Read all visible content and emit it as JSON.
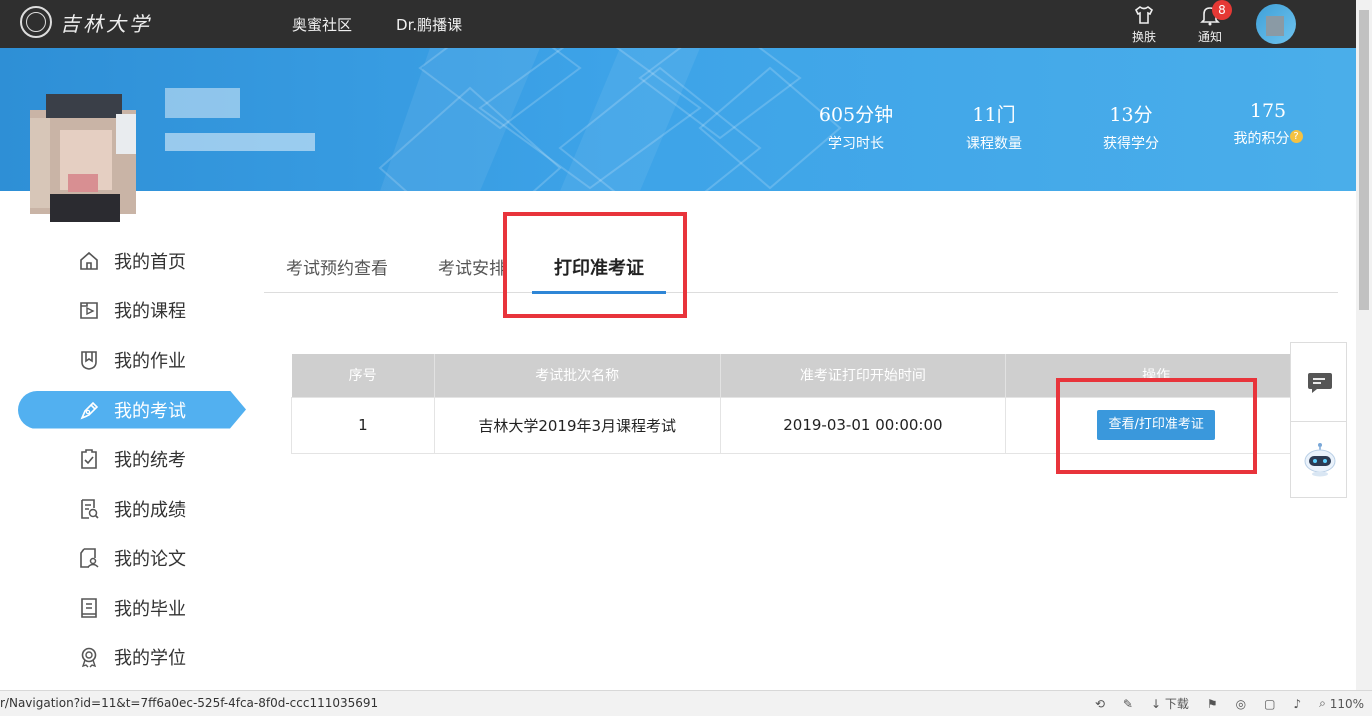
{
  "topbar": {
    "logo_text": "吉林大学",
    "nav": [
      "奥蜜社区",
      "Dr.鹏播课"
    ],
    "skin_label": "换肤",
    "notify_label": "通知",
    "notify_count": "8"
  },
  "stats": [
    {
      "value": "605分钟",
      "label": "学习时长"
    },
    {
      "value": "11门",
      "label": "课程数量"
    },
    {
      "value": "13分",
      "label": "获得学分"
    },
    {
      "value": "175",
      "label": "我的积分"
    }
  ],
  "sidebar": {
    "items": [
      {
        "label": "我的首页",
        "icon": "home-icon"
      },
      {
        "label": "我的课程",
        "icon": "course-icon"
      },
      {
        "label": "我的作业",
        "icon": "homework-icon"
      },
      {
        "label": "我的考试",
        "icon": "exam-icon"
      },
      {
        "label": "我的统考",
        "icon": "unified-exam-icon"
      },
      {
        "label": "我的成绩",
        "icon": "grades-icon"
      },
      {
        "label": "我的论文",
        "icon": "thesis-icon"
      },
      {
        "label": "我的毕业",
        "icon": "graduation-icon"
      },
      {
        "label": "我的学位",
        "icon": "degree-icon"
      }
    ],
    "active_index": 3
  },
  "tabs": [
    {
      "label": "考试预约查看"
    },
    {
      "label": "考试安排"
    },
    {
      "label": "打印准考证"
    }
  ],
  "table": {
    "headers": [
      "序号",
      "考试批次名称",
      "准考证打印开始时间",
      "操作"
    ],
    "rows": [
      {
        "index": "1",
        "batch": "吉林大学2019年3月课程考试",
        "start_time": "2019-03-01 00:00:00",
        "action": "查看/打印准考证"
      }
    ]
  },
  "statusbar": {
    "url": "r/Navigation?id=11&t=7ff6a0ec-525f-4fca-8f0d-ccc111035691",
    "download_label": "下载",
    "zoom": "110%"
  },
  "colors": {
    "topbar": "#2f2f2f",
    "banner": "#3da3e8",
    "accent": "#52b0f0",
    "button": "#3a98dc",
    "highlight": "#e8343b"
  }
}
